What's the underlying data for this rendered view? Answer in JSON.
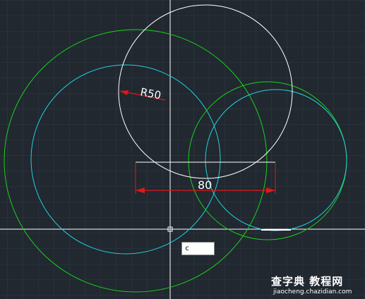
{
  "drawing": {
    "radius_label": "R50",
    "distance_label": "80"
  },
  "command_input": {
    "value": "c"
  },
  "watermark": {
    "main": "查字典 教程网",
    "sub": "jiaocheng.chazidian.com"
  },
  "colors": {
    "background": "#212830",
    "grid": "#2f3945",
    "crosshair": "#ffffff",
    "green_circle": "#19d319",
    "cyan_circle": "#22d0dc",
    "white_circle": "#ffffff",
    "dimension": "#e01818"
  }
}
